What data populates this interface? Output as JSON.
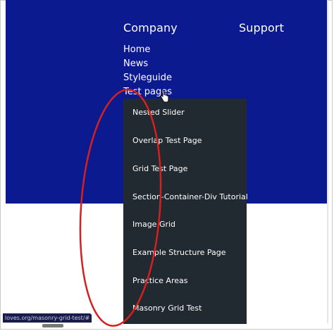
{
  "footer": {
    "company_heading": "Company",
    "support_heading": "Support",
    "company_links": [
      {
        "label": "Home"
      },
      {
        "label": "News"
      },
      {
        "label": "Styleguide"
      },
      {
        "label": "Test pages"
      }
    ]
  },
  "test_pages_menu": {
    "items": [
      {
        "label": "Nested Slider"
      },
      {
        "label": "Overlap Test Page"
      },
      {
        "label": "Grid Test Page"
      },
      {
        "label": "Section-Container-Div Tutorial"
      },
      {
        "label": "Image Grid"
      },
      {
        "label": "Example Structure Page"
      },
      {
        "label": "Practice Areas"
      },
      {
        "label": "Masonry Grid Test"
      }
    ]
  },
  "status_bar": {
    "url": "loves.org/masonry-grid-test/#"
  },
  "colors": {
    "footer_background": "#0b1a8f",
    "dropdown_background": "#222a31",
    "annotation_stroke": "#d61f1f"
  }
}
